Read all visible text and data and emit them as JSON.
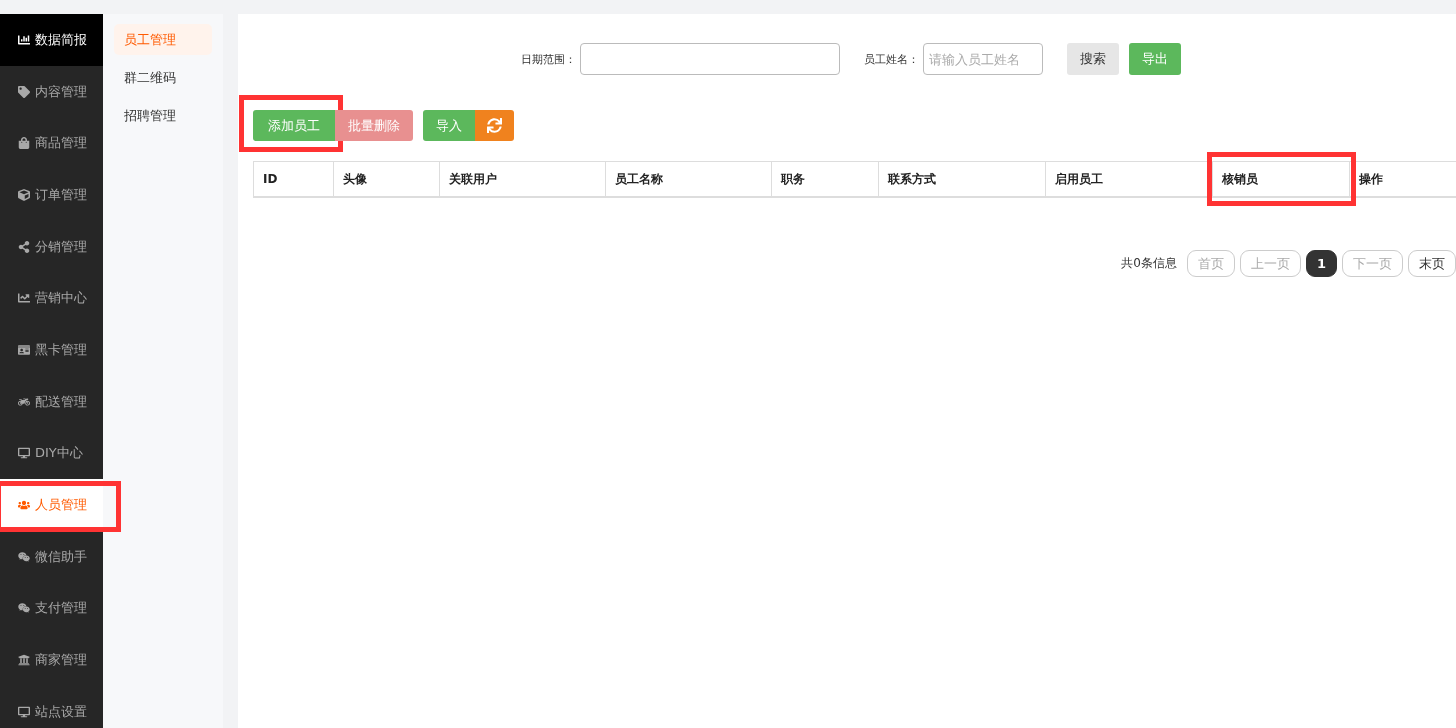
{
  "sidebar": {
    "items": [
      {
        "label": "数据简报",
        "selected": false,
        "featured": true,
        "highlighted": false
      },
      {
        "label": "内容管理",
        "selected": false,
        "featured": false,
        "highlighted": false
      },
      {
        "label": "商品管理",
        "selected": false,
        "featured": false,
        "highlighted": false
      },
      {
        "label": "订单管理",
        "selected": false,
        "featured": false,
        "highlighted": false
      },
      {
        "label": "分销管理",
        "selected": false,
        "featured": false,
        "highlighted": false
      },
      {
        "label": "营销中心",
        "selected": false,
        "featured": false,
        "highlighted": false
      },
      {
        "label": "黑卡管理",
        "selected": false,
        "featured": false,
        "highlighted": false
      },
      {
        "label": "配送管理",
        "selected": false,
        "featured": false,
        "highlighted": false
      },
      {
        "label": "DIY中心",
        "selected": false,
        "featured": false,
        "highlighted": false
      },
      {
        "label": "人员管理",
        "selected": true,
        "featured": false,
        "highlighted": true
      },
      {
        "label": "微信助手",
        "selected": false,
        "featured": false,
        "highlighted": false
      },
      {
        "label": "支付管理",
        "selected": false,
        "featured": false,
        "highlighted": false
      },
      {
        "label": "商家管理",
        "selected": false,
        "featured": false,
        "highlighted": false
      },
      {
        "label": "站点设置",
        "selected": false,
        "featured": false,
        "highlighted": false
      }
    ]
  },
  "submenu": {
    "items": [
      {
        "label": "员工管理",
        "selected": true
      },
      {
        "label": "群二维码",
        "selected": false
      },
      {
        "label": "招聘管理",
        "selected": false
      }
    ]
  },
  "filters": {
    "fields": [
      {
        "label": "日期范围："
      },
      {
        "label": "员工姓名：",
        "placeholder": "请输入员工姓名"
      }
    ],
    "buttons": [
      {
        "label": "搜索",
        "kind": "plain"
      },
      {
        "label": "导出",
        "kind": "green"
      }
    ]
  },
  "toolbar": {
    "buttons": [
      {
        "label": "添加员工",
        "kind": "green",
        "highlighted": true
      },
      {
        "label": "批量删除",
        "kind": "danger",
        "highlighted": false
      },
      {
        "label": "导入",
        "kind": "green",
        "highlighted": false
      },
      {
        "kind": "refresh"
      }
    ]
  },
  "table": {
    "columns": [
      {
        "label": "ID",
        "highlighted": false
      },
      {
        "label": "头像",
        "highlighted": false
      },
      {
        "label": "关联用户",
        "highlighted": false
      },
      {
        "label": "员工名称",
        "highlighted": false
      },
      {
        "label": "职务",
        "highlighted": false
      },
      {
        "label": "联系方式",
        "highlighted": false
      },
      {
        "label": "启用员工",
        "highlighted": false
      },
      {
        "label": "核销员",
        "highlighted": true
      },
      {
        "label": "操作"
      }
    ]
  },
  "pagination": {
    "summary": "共0条信息",
    "pages": [
      {
        "label": "首页",
        "selected": false,
        "disabled": true
      },
      {
        "label": "上一页",
        "selected": false,
        "disabled": true
      },
      {
        "label": "1",
        "selected": true,
        "disabled": false
      },
      {
        "label": "下一页",
        "selected": false,
        "disabled": true
      },
      {
        "label": "末页",
        "selected": false,
        "disabled": false
      }
    ]
  }
}
